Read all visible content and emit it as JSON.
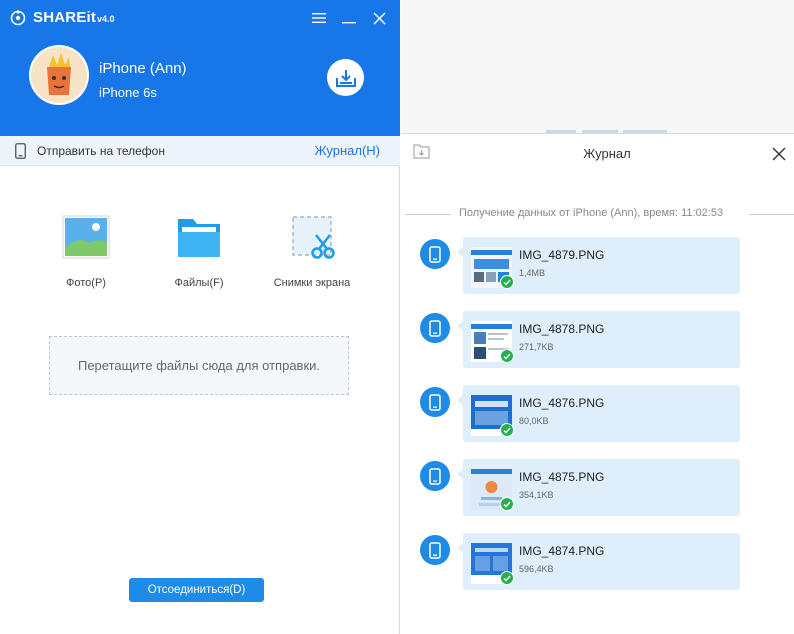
{
  "app": {
    "title": "SHAREit",
    "version": "v4.0"
  },
  "device": {
    "name": "iPhone (Ann)",
    "model": "iPhone 6s"
  },
  "sendbar": {
    "label": "Отправить на телефон",
    "journal_link": "Журнал(H)"
  },
  "categories": [
    {
      "label": "Фото(P)",
      "icon": "photo-icon"
    },
    {
      "label": "Файлы(F)",
      "icon": "folder-icon"
    },
    {
      "label": "Снимки экрана",
      "icon": "screenshot-icon"
    }
  ],
  "dropzone": {
    "text": "Перетащите файлы сюда для отправки."
  },
  "disconnect_label": "Отсоединиться(D)",
  "journal": {
    "title": "Журнал",
    "session_text": "Получение данных от iPhone (Ann), время: 11:02:53",
    "files": [
      {
        "name": "IMG_4879.PNG",
        "size": "1,4MB"
      },
      {
        "name": "IMG_4878.PNG",
        "size": "271,7KB"
      },
      {
        "name": "IMG_4876.PNG",
        "size": "80,0KB"
      },
      {
        "name": "IMG_4875.PNG",
        "size": "354,1KB"
      },
      {
        "name": "IMG_4874.PNG",
        "size": "596,4KB"
      }
    ]
  },
  "colors": {
    "brand": "#1776e8",
    "button": "#1e8be6",
    "card": "#dfeefb",
    "success": "#22b14c"
  }
}
